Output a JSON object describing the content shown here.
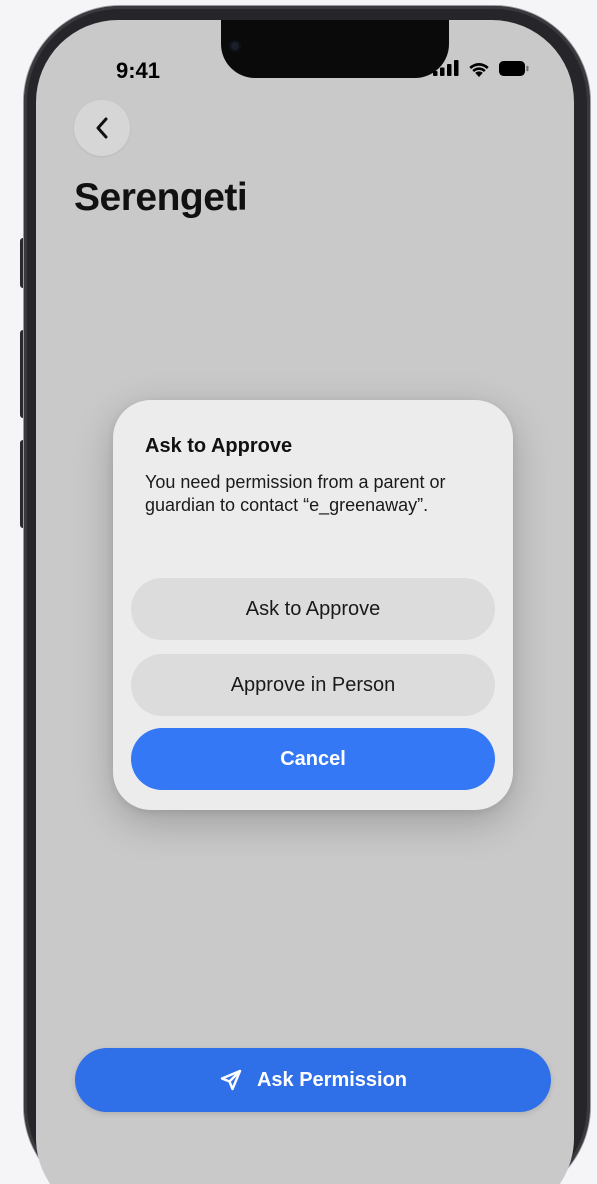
{
  "status_bar": {
    "time": "9:41",
    "icons": [
      "cellular-signal-icon",
      "wifi-icon",
      "battery-icon"
    ]
  },
  "nav": {
    "back_icon": "chevron-left-icon"
  },
  "page": {
    "title": "Serengeti"
  },
  "alert": {
    "title": "Ask to Approve",
    "message": "You need permission from a parent or guardian to contact “e_greenaway”.",
    "buttons": {
      "ask_to_approve": "Ask to Approve",
      "approve_in_person": "Approve in Person",
      "cancel": "Cancel"
    }
  },
  "footer": {
    "ask_permission_label": "Ask Permission",
    "ask_permission_icon": "paper-plane-icon"
  },
  "colors": {
    "accent": "#3478f6",
    "screen_background": "#c9c9c9",
    "dialog_background": "#ececec"
  }
}
